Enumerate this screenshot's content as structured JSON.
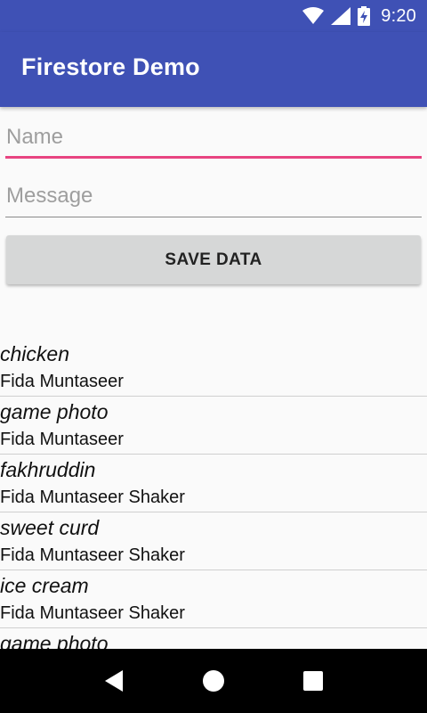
{
  "status_bar": {
    "time": "9:20",
    "icons": [
      "wifi-icon",
      "cell-signal-icon",
      "battery-charging-icon"
    ]
  },
  "app_bar": {
    "title": "Firestore Demo"
  },
  "form": {
    "name_placeholder": "Name",
    "name_value": "",
    "message_placeholder": "Message",
    "message_value": "",
    "save_label": "SAVE DATA"
  },
  "list": {
    "items": [
      {
        "title": "chicken",
        "author": "Fida Muntaseer"
      },
      {
        "title": "game photo",
        "author": "Fida Muntaseer"
      },
      {
        "title": "fakhruddin",
        "author": "Fida Muntaseer Shaker"
      },
      {
        "title": "sweet curd",
        "author": "Fida Muntaseer Shaker"
      },
      {
        "title": "ice cream",
        "author": "Fida Muntaseer Shaker"
      },
      {
        "title": "game photo",
        "author": ""
      }
    ]
  },
  "nav_bar": {
    "icons": [
      "back-icon",
      "home-icon",
      "recents-icon"
    ]
  },
  "colors": {
    "primary": "#3f51b5",
    "accent": "#e84481",
    "button": "#d6d7d7"
  }
}
